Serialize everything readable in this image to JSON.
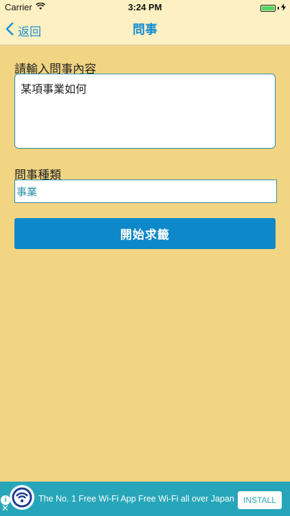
{
  "status_bar": {
    "carrier": "Carrier",
    "time": "3:24 PM",
    "battery_level": 1.0,
    "battery_color": "#4cd964"
  },
  "nav": {
    "back_label": "返回",
    "title": "問事",
    "accent": "#1a8fd3"
  },
  "form": {
    "content_label": "請輸入問事內容",
    "content_value": "某項事業如何",
    "type_label": "問事種類",
    "type_value": "事業",
    "submit_label": "開始求籤"
  },
  "ad": {
    "info_icon": "info-icon",
    "close_icon": "close-icon",
    "text": "The No. 1 Free Wi-Fi App Free Wi-Fi all over Japan",
    "install_label": "INSTALL"
  },
  "colors": {
    "background": "#f2d582",
    "header": "#fdf0c3",
    "button": "#0d88c9",
    "ad_banner": "#27a6ba"
  }
}
